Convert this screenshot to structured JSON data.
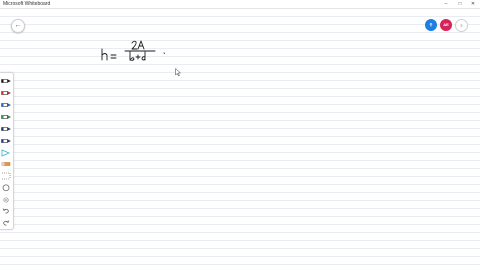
{
  "window": {
    "title": "Microsoft Whiteboard",
    "minimize_glyph": "–",
    "maximize_glyph": "□",
    "close_glyph": "✕"
  },
  "header": {
    "back_glyph": "←",
    "share_glyph": "⚲",
    "avatar_initials": "AE",
    "menu_glyph": "≡"
  },
  "colors": {
    "share_button": "#1f7fe0",
    "avatar": "#d6245a",
    "ink": "#1a1a1a",
    "ruled_lines": "#e9edf3"
  },
  "toolbar": {
    "tools": [
      {
        "name": "black-pen",
        "icon": "pen-icon",
        "color": "#1a1a1a"
      },
      {
        "name": "red-pen",
        "icon": "pen-icon",
        "color": "#d9302c"
      },
      {
        "name": "blue-pen",
        "icon": "pen-icon",
        "color": "#1f6fd6"
      },
      {
        "name": "green-pen",
        "icon": "pen-icon",
        "color": "#2a9a4a"
      },
      {
        "name": "dark-pen",
        "icon": "pen-icon",
        "color": "#1b3c6b"
      },
      {
        "name": "navy-pen",
        "icon": "pen-icon",
        "color": "#243a8a"
      },
      {
        "name": "highlighter",
        "icon": "highlighter-icon",
        "color": "#35b6c8"
      },
      {
        "name": "eraser",
        "icon": "eraser-icon",
        "color": "#e89a3a"
      },
      {
        "name": "ruler",
        "icon": "ruler-icon",
        "color": "#555555"
      },
      {
        "name": "lasso",
        "icon": "lasso-icon",
        "color": "#555555"
      },
      {
        "name": "settings",
        "icon": "gear-icon",
        "color": "#777777"
      },
      {
        "name": "undo",
        "icon": "undo-icon",
        "color": "#555555"
      },
      {
        "name": "redo",
        "icon": "redo-icon",
        "color": "#555555"
      }
    ]
  },
  "canvas": {
    "handwriting": "h = 2A / (b+d)"
  }
}
